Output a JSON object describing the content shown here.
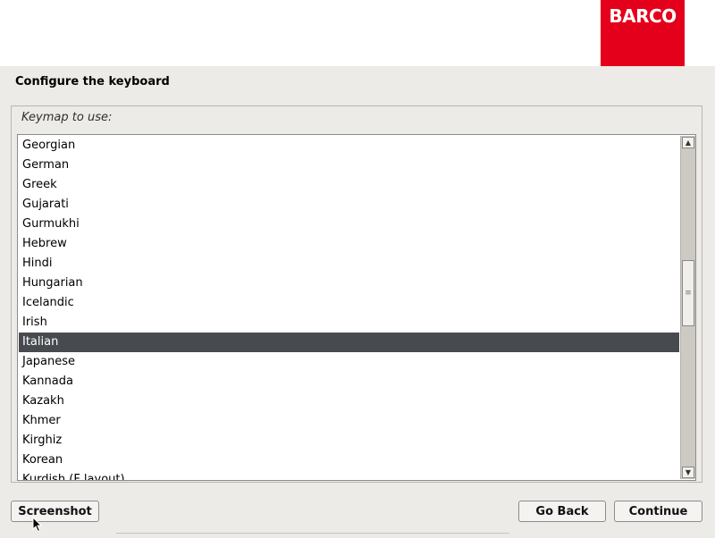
{
  "header": {
    "logo_text": "BARCO",
    "logo_color": "#e4001b"
  },
  "page": {
    "title": "Configure the keyboard",
    "keymap_label": "Keymap to use:"
  },
  "keymap_list": {
    "items": [
      "Georgian",
      "German",
      "Greek",
      "Gujarati",
      "Gurmukhi",
      "Hebrew",
      "Hindi",
      "Hungarian",
      "Icelandic",
      "Irish",
      "Italian",
      "Japanese",
      "Kannada",
      "Kazakh",
      "Khmer",
      "Kirghiz",
      "Korean",
      "Kurdish (F layout)"
    ],
    "selected": "Italian"
  },
  "scrollbar": {
    "up_icon": "▲",
    "down_icon": "▼",
    "grip_icon": "≡"
  },
  "buttons": {
    "screenshot": "Screenshot",
    "go_back": "Go Back",
    "continue": "Continue"
  },
  "colors": {
    "selection": "#474b4f",
    "background": "#edebe7"
  }
}
